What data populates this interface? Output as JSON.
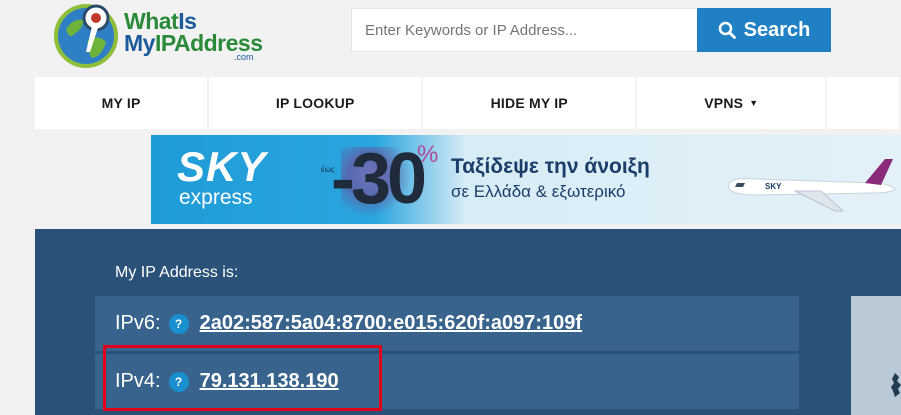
{
  "logo": {
    "line1_a": "What",
    "line1_b": "Is",
    "line2_a": "My",
    "line2_b": "IPAddress",
    "dotcom": ".com"
  },
  "search": {
    "placeholder": "Enter Keywords or IP Address...",
    "value": "",
    "button_label": "Search",
    "button_icon": "search-icon"
  },
  "nav": {
    "items": [
      {
        "label": "MY IP"
      },
      {
        "label": "IP LOOKUP"
      },
      {
        "label": "HIDE MY IP"
      },
      {
        "label": "VPNS",
        "caret": "▼"
      }
    ]
  },
  "banner": {
    "brand": "SKY",
    "brand_sub": "express",
    "promo_prefix": "έως",
    "promo_value": "-30",
    "promo_unit": "%",
    "headline": "Ταξίδεψε την άνοιξη",
    "subline": "σε Ελλάδα & εξωτερικό",
    "plane_tail_text": "SKY"
  },
  "ip": {
    "heading": "My IP Address is:",
    "v6": {
      "label": "IPv6:",
      "help": "?",
      "value": "2a02:587:5a04:8700:e015:620f:a097:109f"
    },
    "v4": {
      "label": "IPv4:",
      "help": "?",
      "value": "79.131.138.190"
    }
  },
  "colors": {
    "page_bg": "#f2f2f2",
    "search_button": "#1f80c4",
    "panel_bg": "#2a5279",
    "row_bg": "#37638c",
    "highlight": "#e2001a",
    "help_icon": "#1a8fd0"
  }
}
